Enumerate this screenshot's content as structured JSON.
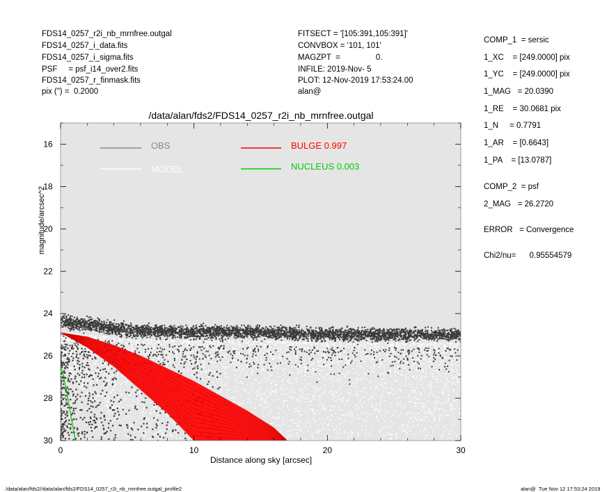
{
  "header_left": [
    "FDS14_0257_r2i_nb_mrnfree.outgal",
    "FDS14_0257_i_data.fits",
    "FDS14_0257_i_sigma.fits",
    "PSF     = psf_i14_over2.fits",
    "FDS14_0257_r_finmask.fits",
    "pix (\") =  0.2000"
  ],
  "header_mid": [
    "FITSECT = '[105:391,105:391]'",
    "CONVBOX = '101, 101'",
    "MAGZPT  =                0.",
    "INFILE: 2019-Nov- 5",
    "PLOT: 12-Nov-2019 17:53:24.00",
    "alan@"
  ],
  "right_panel": {
    "comp1": "COMP_1  = sersic",
    "xc": "1_XC    = [249.0000] pix",
    "yc": "1_YC    = [249.0000] pix",
    "mag": "1_MAG   = 20.0390",
    "re": "1_RE    = 30.0681 pix",
    "n": "1_N     = 0.7791",
    "ar": "1_AR    = [0.6643]",
    "pa": "1_PA    = [13.0787]",
    "comp2": "COMP_2  = psf",
    "mag2": "2_MAG   = 26.2720",
    "error": "ERROR   = Convergence",
    "chi2": "Chi2/nu=      0.95554579"
  },
  "footer": {
    "left": "/data/alan/fds2//data/alan/fds2/FDS14_0257_r2i_nb_mrnfree.outgal_profile2",
    "right": "alan@  Tue Nov 12 17:53:24 2019"
  },
  "colors": {
    "plot_bg": "#e5e5e5",
    "obs": "#888888",
    "model": "#ffffff",
    "bulge": "#ff0000",
    "nucleus": "#00cc00",
    "points_dark": "#3a3a3a"
  },
  "chart_data": {
    "type": "scatter",
    "title": "/data/alan/fds2/FDS14_0257_r2i_nb_mrnfree.outgal",
    "xlabel": "Distance along sky [arcsec]",
    "ylabel": "magnitude/arcsec^2",
    "xlim": [
      0,
      30
    ],
    "ylim": [
      30,
      15
    ],
    "y_inverted": true,
    "xticks": [
      "0",
      "10",
      "20",
      "30"
    ],
    "yticks": [
      "16",
      "18",
      "20",
      "22",
      "24",
      "26",
      "28",
      "30"
    ],
    "legend": [
      {
        "label": "OBS",
        "color": "#888888"
      },
      {
        "label": "BULGE  0.997",
        "color": "#ff0000"
      },
      {
        "label": "MODEL",
        "color": "#ffffff"
      },
      {
        "label": "NUCLEUS  0.003",
        "color": "#00cc00"
      }
    ],
    "series": [
      {
        "name": "OBS",
        "kind": "scatter-band",
        "x": [
          0,
          2,
          5,
          10,
          15,
          20,
          25,
          30
        ],
        "y": [
          24.4,
          24.5,
          24.8,
          24.9,
          24.9,
          25.0,
          25.0,
          25.0
        ],
        "spread": 0.6
      },
      {
        "name": "MODEL",
        "kind": "scatter-cloud",
        "x": [
          0,
          5,
          10,
          15,
          20,
          30
        ],
        "y_low": [
          24.9,
          25.2,
          25.3,
          25.3,
          25.4,
          25.4
        ],
        "y_high": [
          26.5,
          30,
          30,
          30,
          30,
          30
        ]
      },
      {
        "name": "BULGE  0.997",
        "kind": "band",
        "x": [
          0,
          2,
          4,
          6,
          8,
          10,
          12,
          14,
          16,
          17
        ],
        "y_upper": [
          24.9,
          25.1,
          25.5,
          26.0,
          26.6,
          27.2,
          27.9,
          28.6,
          29.4,
          30.0
        ],
        "y_lower": [
          24.9,
          25.6,
          26.5,
          27.6,
          28.7,
          30.0,
          30.0,
          30.0,
          30.0,
          30.0
        ]
      },
      {
        "name": "NUCLEUS  0.003",
        "kind": "line",
        "x": [
          0,
          0.2,
          0.4,
          0.6,
          0.8,
          1.0,
          1.1
        ],
        "y": [
          26.5,
          26.9,
          27.5,
          28.2,
          28.9,
          29.6,
          30.0
        ]
      }
    ]
  }
}
